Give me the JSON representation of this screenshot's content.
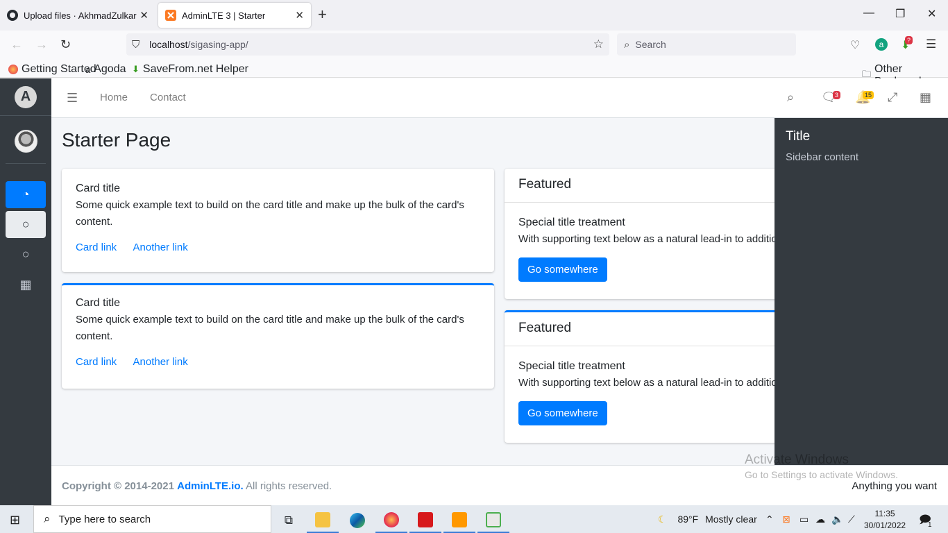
{
  "browser": {
    "tabs": [
      {
        "title": "Upload files · AkhmadZulkarnain",
        "close": "✕"
      },
      {
        "title": "AdminLTE 3 | Starter",
        "close": "✕"
      }
    ],
    "new_tab": "+",
    "window_controls": {
      "minimize": "—",
      "restore": "❐",
      "close": "✕"
    },
    "url_host": "localhost",
    "url_path": "/sigasing-app/",
    "search_placeholder": "Search",
    "bookmarks": [
      "Getting Started",
      "Agoda",
      "SaveFrom.net Helper"
    ],
    "other_bookmarks": "Other Bookmarks",
    "addon_badge": "?"
  },
  "app": {
    "nav_links": [
      "Home",
      "Contact"
    ],
    "messages_badge": "3",
    "notifications_badge": "15",
    "page_title": "Starter Page",
    "cards": [
      {
        "title": "Card title",
        "text": "Some quick example text to build on the card title and make up the bulk of the card's content.",
        "link1": "Card link",
        "link2": "Another link"
      },
      {
        "title": "Card title",
        "text": "Some quick example text to build on the card title and make up the bulk of the card's content.",
        "link1": "Card link",
        "link2": "Another link"
      }
    ],
    "featured": [
      {
        "header": "Featured",
        "title": "Special title treatment",
        "text": "With supporting text below as a natural lead-in to additional content.",
        "button": "Go somewhere"
      },
      {
        "header": "Featured",
        "title": "Special title treatment",
        "text": "With supporting text below as a natural lead-in to additional content.",
        "button": "Go somewhere"
      }
    ],
    "control_sidebar": {
      "title": "Title",
      "content": "Sidebar content"
    },
    "footer": {
      "copyright": "Copyright © 2014-2021",
      "link": "AdminLTE.io.",
      "rights": "All rights reserved.",
      "right_text": "Anything you want"
    },
    "colors": {
      "primary": "#007bff",
      "sidebar": "#343a40",
      "badge_danger": "#dc3545",
      "badge_warning": "#ffc107"
    }
  },
  "watermark": {
    "line1": "Activate Windows",
    "line2": "Go to Settings to activate Windows."
  },
  "taskbar": {
    "search_placeholder": "Type here to search",
    "weather_temp": "89°F",
    "weather_text": "Mostly clear",
    "time": "11:35",
    "date": "30/01/2022",
    "notification_count": "1"
  }
}
